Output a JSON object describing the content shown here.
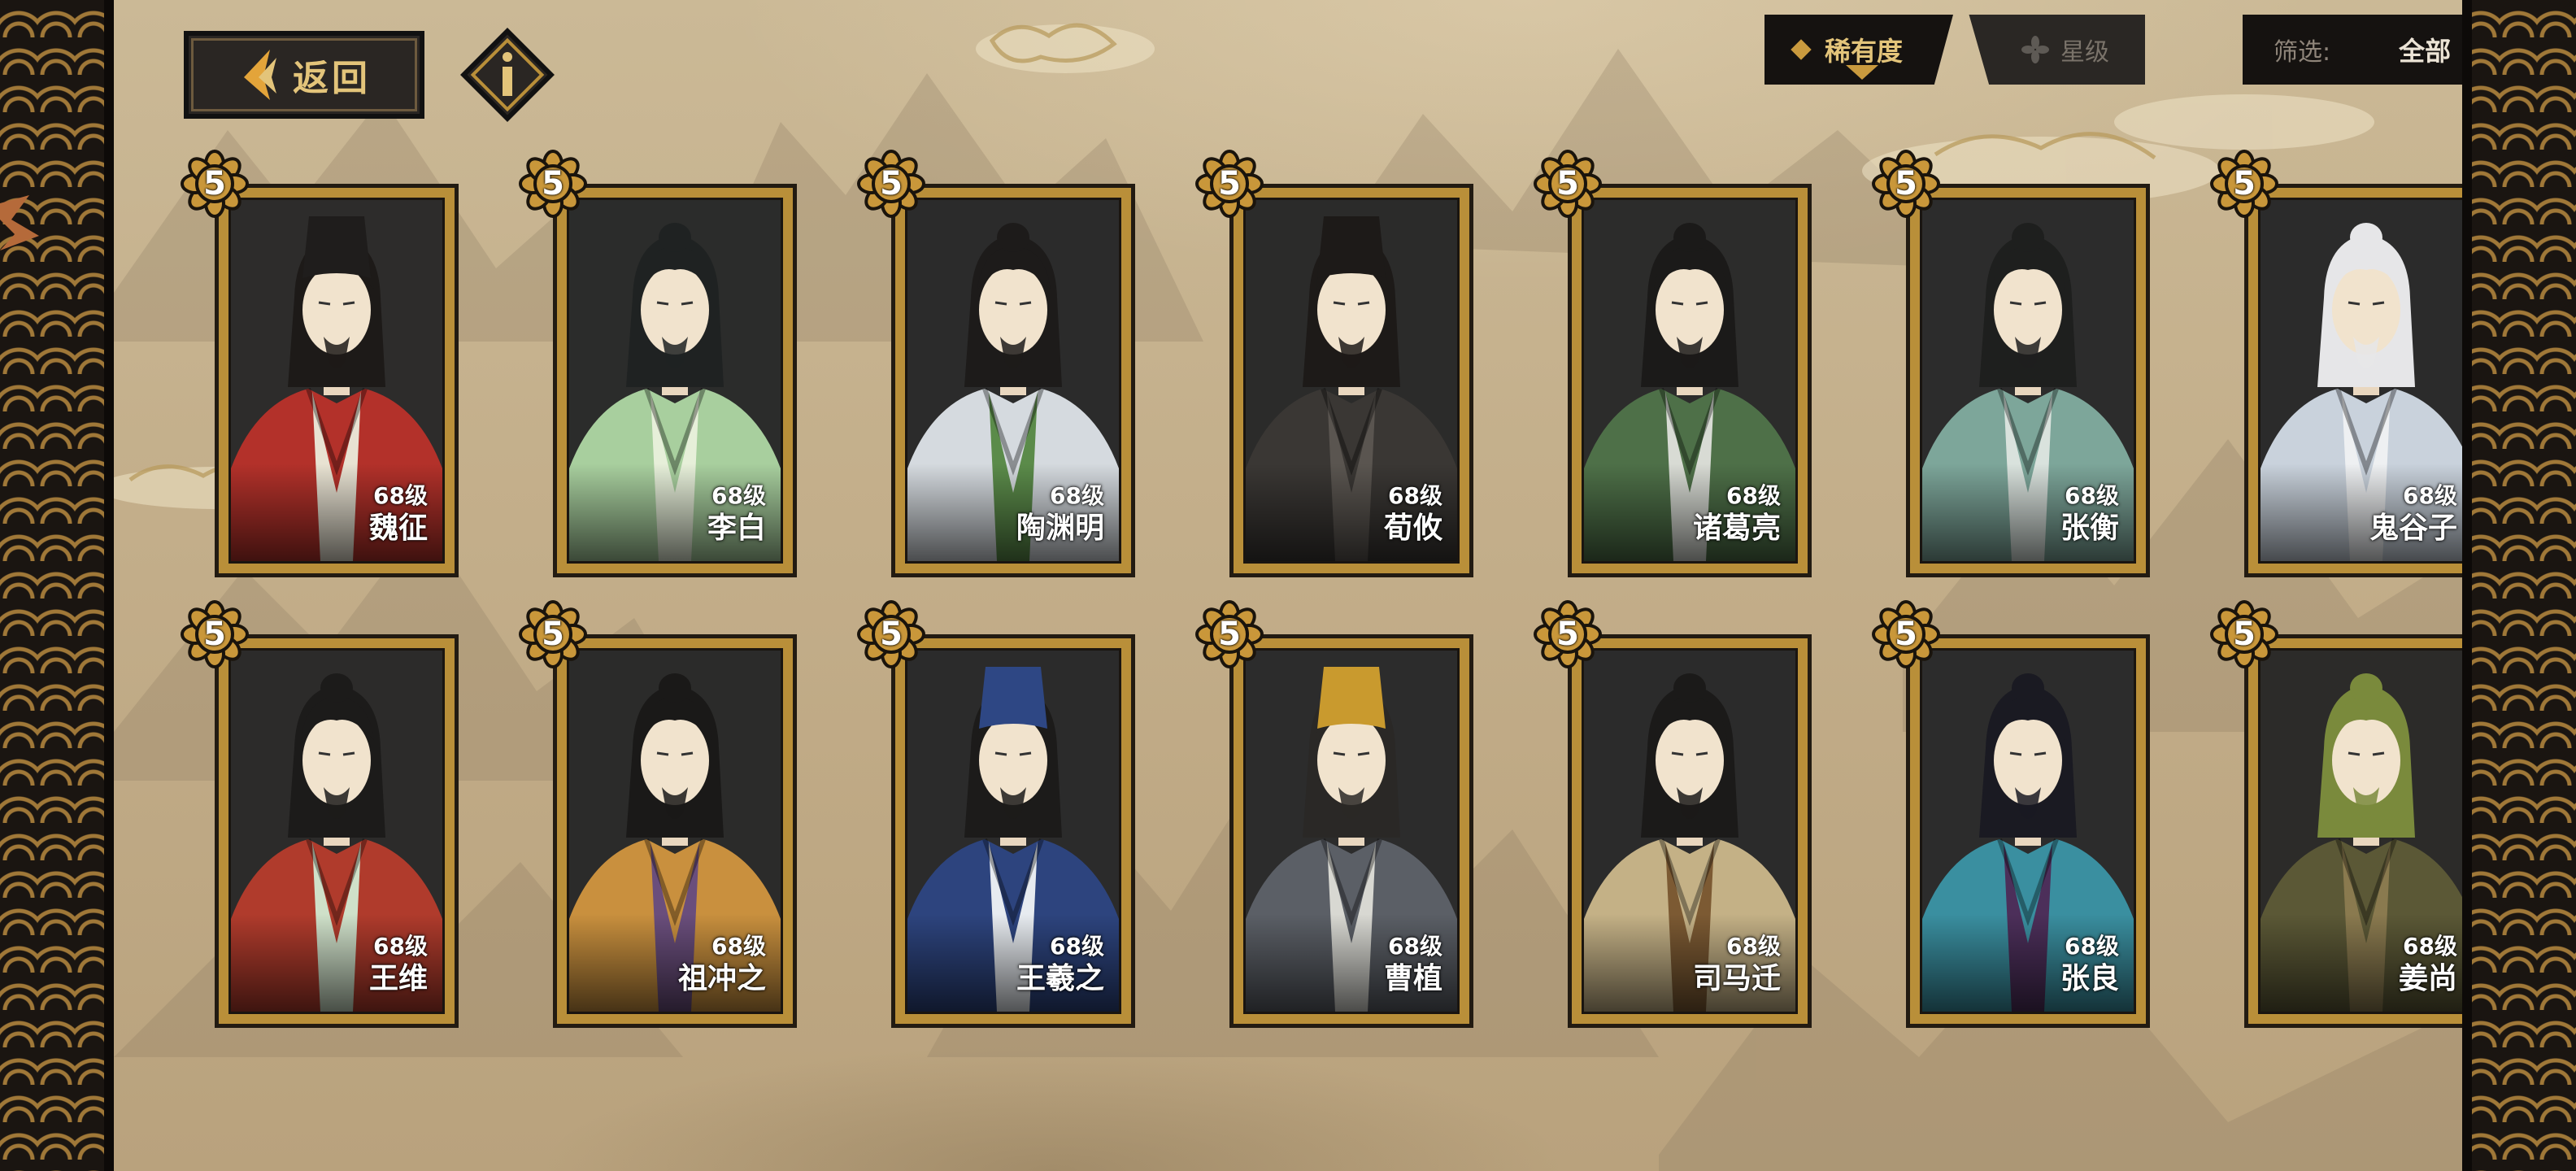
{
  "header": {
    "back_label": "返回",
    "back_icon": "chevron-left-icon",
    "info_icon": "info-icon"
  },
  "tabs": [
    {
      "label": "稀有度",
      "icon": "diamond-icon",
      "active": true
    },
    {
      "label": "星级",
      "icon": "flower-star-icon",
      "active": false
    }
  ],
  "filter": {
    "label": "筛选:",
    "value": "全部",
    "more": "•••"
  },
  "colors": {
    "gold": "#b98f39",
    "gold_text": "#e3c47a",
    "parchment": "#c3ae8a",
    "dark": "#151210"
  },
  "cards": [
    {
      "stars": "5",
      "level": "68级",
      "name": "魏征",
      "robe": "#b3312a",
      "inner": "#e8e2d2",
      "hat": "#1f1d1c",
      "hair": "#1d1a18",
      "bg": "#2d2c2b"
    },
    {
      "stars": "5",
      "level": "68级",
      "name": "李白",
      "robe": "#a8cf9e",
      "inner": "#e6efd9",
      "hat": "",
      "hair": "#1f2222",
      "bg": "#2b2c2b"
    },
    {
      "stars": "5",
      "level": "68级",
      "name": "陶渊明",
      "robe": "#d5dadf",
      "inner": "#5b8b4a",
      "hat": "",
      "hair": "#1d1b1a",
      "bg": "#2b2b2b"
    },
    {
      "stars": "5",
      "level": "68级",
      "name": "荀攸",
      "robe": "#3a3734",
      "inner": "#5a5550",
      "hat": "#1d1a18",
      "hair": "#1d1a18",
      "bg": "#2b2b2a"
    },
    {
      "stars": "5",
      "level": "68级",
      "name": "诸葛亮",
      "robe": "#4e7048",
      "inner": "#d8dbd4",
      "hat": "",
      "hair": "#1b1a19",
      "bg": "#2c2c2b"
    },
    {
      "stars": "5",
      "level": "68级",
      "name": "张衡",
      "robe": "#7da69a",
      "inner": "#d9e2dd",
      "hat": "",
      "hair": "#1e1f1e",
      "bg": "#2c2c2c"
    },
    {
      "stars": "5",
      "level": "68级",
      "name": "鬼谷子",
      "robe": "#c9d2dc",
      "inner": "#eef0f2",
      "hat": "",
      "hair": "#e6e6e8",
      "bg": "#2b2b2b"
    },
    {
      "stars": "5",
      "level": "68级",
      "name": "王维",
      "robe": "#b03b2c",
      "inner": "#cfe0c9",
      "hat": "",
      "hair": "#1c1b1a",
      "bg": "#2c2b2a"
    },
    {
      "stars": "5",
      "level": "68级",
      "name": "祖冲之",
      "robe": "#c9903e",
      "inner": "#6a4e7c",
      "hat": "",
      "hair": "#1a1918",
      "bg": "#2b2b2a"
    },
    {
      "stars": "5",
      "level": "68级",
      "name": "王羲之",
      "robe": "#2d447e",
      "inner": "#e7ebf0",
      "hat": "#2e4784",
      "hair": "#1c1b1a",
      "bg": "#2b2b2b"
    },
    {
      "stars": "5",
      "level": "68级",
      "name": "曹植",
      "robe": "#5b5f66",
      "inner": "#d8d8d2",
      "hat": "#c99a2e",
      "hair": "#2a2826",
      "bg": "#2c2c2c"
    },
    {
      "stars": "5",
      "level": "68级",
      "name": "司马迁",
      "robe": "#c4b186",
      "inner": "#7c5a33",
      "hat": "",
      "hair": "#1b1a19",
      "bg": "#2b2b2b"
    },
    {
      "stars": "5",
      "level": "68级",
      "name": "张良",
      "robe": "#3a8fa0",
      "inner": "#4c2f5a",
      "hat": "",
      "hair": "#1a1a22",
      "bg": "#2c2c2c"
    },
    {
      "stars": "5",
      "level": "68级",
      "name": "姜尚",
      "robe": "#5b5836",
      "inner": "#8a7a4f",
      "hat": "",
      "hair": "#7a8a3c",
      "bg": "#2c2b29"
    }
  ]
}
